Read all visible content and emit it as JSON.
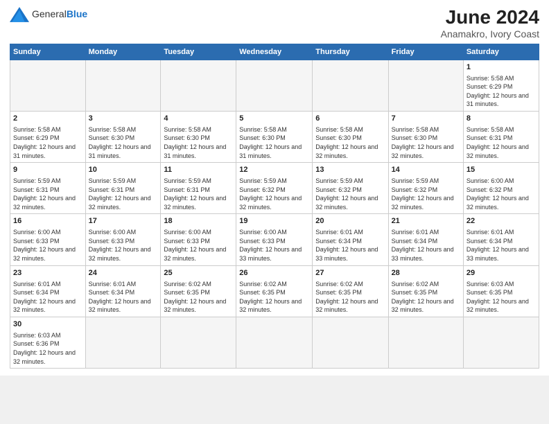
{
  "logo": {
    "text_general": "General",
    "text_blue": "Blue"
  },
  "title": "June 2024",
  "subtitle": "Anamakro, Ivory Coast",
  "weekdays": [
    "Sunday",
    "Monday",
    "Tuesday",
    "Wednesday",
    "Thursday",
    "Friday",
    "Saturday"
  ],
  "weeks": [
    [
      {
        "day": "",
        "info": ""
      },
      {
        "day": "",
        "info": ""
      },
      {
        "day": "",
        "info": ""
      },
      {
        "day": "",
        "info": ""
      },
      {
        "day": "",
        "info": ""
      },
      {
        "day": "",
        "info": ""
      },
      {
        "day": "1",
        "info": "Sunrise: 5:58 AM\nSunset: 6:29 PM\nDaylight: 12 hours and 31 minutes."
      }
    ],
    [
      {
        "day": "2",
        "info": "Sunrise: 5:58 AM\nSunset: 6:29 PM\nDaylight: 12 hours and 31 minutes."
      },
      {
        "day": "3",
        "info": "Sunrise: 5:58 AM\nSunset: 6:30 PM\nDaylight: 12 hours and 31 minutes."
      },
      {
        "day": "4",
        "info": "Sunrise: 5:58 AM\nSunset: 6:30 PM\nDaylight: 12 hours and 31 minutes."
      },
      {
        "day": "5",
        "info": "Sunrise: 5:58 AM\nSunset: 6:30 PM\nDaylight: 12 hours and 31 minutes."
      },
      {
        "day": "6",
        "info": "Sunrise: 5:58 AM\nSunset: 6:30 PM\nDaylight: 12 hours and 32 minutes."
      },
      {
        "day": "7",
        "info": "Sunrise: 5:58 AM\nSunset: 6:30 PM\nDaylight: 12 hours and 32 minutes."
      },
      {
        "day": "8",
        "info": "Sunrise: 5:58 AM\nSunset: 6:31 PM\nDaylight: 12 hours and 32 minutes."
      }
    ],
    [
      {
        "day": "9",
        "info": "Sunrise: 5:59 AM\nSunset: 6:31 PM\nDaylight: 12 hours and 32 minutes."
      },
      {
        "day": "10",
        "info": "Sunrise: 5:59 AM\nSunset: 6:31 PM\nDaylight: 12 hours and 32 minutes."
      },
      {
        "day": "11",
        "info": "Sunrise: 5:59 AM\nSunset: 6:31 PM\nDaylight: 12 hours and 32 minutes."
      },
      {
        "day": "12",
        "info": "Sunrise: 5:59 AM\nSunset: 6:32 PM\nDaylight: 12 hours and 32 minutes."
      },
      {
        "day": "13",
        "info": "Sunrise: 5:59 AM\nSunset: 6:32 PM\nDaylight: 12 hours and 32 minutes."
      },
      {
        "day": "14",
        "info": "Sunrise: 5:59 AM\nSunset: 6:32 PM\nDaylight: 12 hours and 32 minutes."
      },
      {
        "day": "15",
        "info": "Sunrise: 6:00 AM\nSunset: 6:32 PM\nDaylight: 12 hours and 32 minutes."
      }
    ],
    [
      {
        "day": "16",
        "info": "Sunrise: 6:00 AM\nSunset: 6:33 PM\nDaylight: 12 hours and 32 minutes."
      },
      {
        "day": "17",
        "info": "Sunrise: 6:00 AM\nSunset: 6:33 PM\nDaylight: 12 hours and 32 minutes."
      },
      {
        "day": "18",
        "info": "Sunrise: 6:00 AM\nSunset: 6:33 PM\nDaylight: 12 hours and 32 minutes."
      },
      {
        "day": "19",
        "info": "Sunrise: 6:00 AM\nSunset: 6:33 PM\nDaylight: 12 hours and 33 minutes."
      },
      {
        "day": "20",
        "info": "Sunrise: 6:01 AM\nSunset: 6:34 PM\nDaylight: 12 hours and 33 minutes."
      },
      {
        "day": "21",
        "info": "Sunrise: 6:01 AM\nSunset: 6:34 PM\nDaylight: 12 hours and 33 minutes."
      },
      {
        "day": "22",
        "info": "Sunrise: 6:01 AM\nSunset: 6:34 PM\nDaylight: 12 hours and 33 minutes."
      }
    ],
    [
      {
        "day": "23",
        "info": "Sunrise: 6:01 AM\nSunset: 6:34 PM\nDaylight: 12 hours and 32 minutes."
      },
      {
        "day": "24",
        "info": "Sunrise: 6:01 AM\nSunset: 6:34 PM\nDaylight: 12 hours and 32 minutes."
      },
      {
        "day": "25",
        "info": "Sunrise: 6:02 AM\nSunset: 6:35 PM\nDaylight: 12 hours and 32 minutes."
      },
      {
        "day": "26",
        "info": "Sunrise: 6:02 AM\nSunset: 6:35 PM\nDaylight: 12 hours and 32 minutes."
      },
      {
        "day": "27",
        "info": "Sunrise: 6:02 AM\nSunset: 6:35 PM\nDaylight: 12 hours and 32 minutes."
      },
      {
        "day": "28",
        "info": "Sunrise: 6:02 AM\nSunset: 6:35 PM\nDaylight: 12 hours and 32 minutes."
      },
      {
        "day": "29",
        "info": "Sunrise: 6:03 AM\nSunset: 6:35 PM\nDaylight: 12 hours and 32 minutes."
      }
    ],
    [
      {
        "day": "30",
        "info": "Sunrise: 6:03 AM\nSunset: 6:36 PM\nDaylight: 12 hours and 32 minutes."
      },
      {
        "day": "",
        "info": ""
      },
      {
        "day": "",
        "info": ""
      },
      {
        "day": "",
        "info": ""
      },
      {
        "day": "",
        "info": ""
      },
      {
        "day": "",
        "info": ""
      },
      {
        "day": "",
        "info": ""
      }
    ]
  ]
}
